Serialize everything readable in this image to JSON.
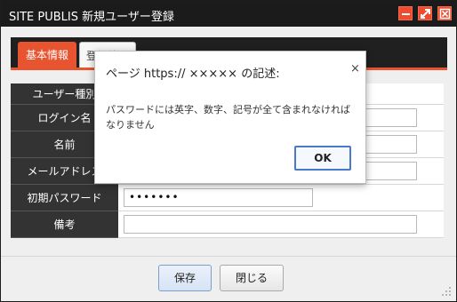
{
  "window": {
    "title": "SITE PUBLIS 新規ユーザー登録"
  },
  "tabs": {
    "basic": "基本情報",
    "registration": "登録情報"
  },
  "form": {
    "user_type_label": "ユーザー種別",
    "login_label": "ログイン名",
    "name_label": "名前",
    "email_label": "メールアドレス",
    "password_label": "初期パスワード",
    "password_value": "•••••••",
    "notes_label": "備考"
  },
  "buttons": {
    "save": "保存",
    "close": "閉じる"
  },
  "dialog": {
    "title": "ページ https:// ××××× の記述:",
    "close_glyph": "×",
    "message": "パスワードには英字、数字、記号が全て含まれなければなりません",
    "ok": "OK"
  },
  "colors": {
    "accent": "#e8542f",
    "titlebar": "#1b1b1b",
    "label_bg": "#333333"
  }
}
